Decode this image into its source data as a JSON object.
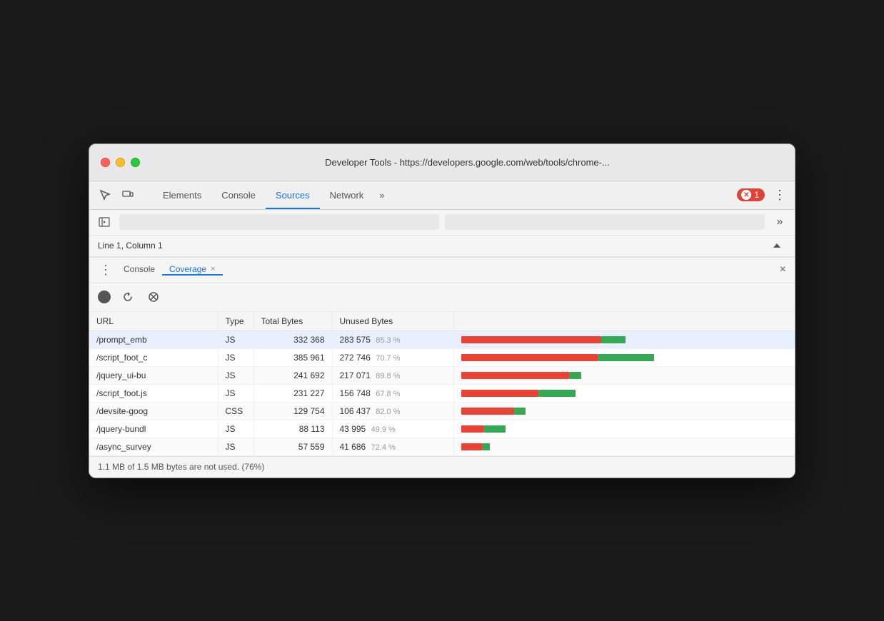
{
  "window": {
    "title": "Developer Tools - https://developers.google.com/web/tools/chrome-..."
  },
  "tabs": {
    "items": [
      {
        "id": "elements",
        "label": "Elements",
        "active": false
      },
      {
        "id": "console",
        "label": "Console",
        "active": false
      },
      {
        "id": "sources",
        "label": "Sources",
        "active": true
      },
      {
        "id": "network",
        "label": "Network",
        "active": false
      }
    ],
    "more_label": "»",
    "error_count": "1",
    "menu_label": "⋮"
  },
  "status": {
    "line_col": "Line 1, Column 1"
  },
  "drawer": {
    "tabs": [
      {
        "id": "console",
        "label": "Console",
        "active": false,
        "closable": false
      },
      {
        "id": "coverage",
        "label": "Coverage",
        "active": true,
        "closable": true
      }
    ],
    "close_label": "×"
  },
  "coverage": {
    "toolbar": {
      "record_title": "Start/Stop recording",
      "reload_title": "Reload and start recording",
      "clear_title": "Clear all"
    },
    "table": {
      "headers": [
        "URL",
        "Type",
        "Total Bytes",
        "Unused Bytes",
        ""
      ],
      "rows": [
        {
          "url": "/prompt_emb",
          "type": "JS",
          "total": "332 368",
          "unused": "283 575",
          "unused_pct": "85.3 %",
          "used_pct": 14.7,
          "bar_total_width": 230
        },
        {
          "url": "/script_foot_c",
          "type": "JS",
          "total": "385 961",
          "unused": "272 746",
          "unused_pct": "70.7 %",
          "used_pct": 29.3,
          "bar_total_width": 270
        },
        {
          "url": "/jquery_ui-bu",
          "type": "JS",
          "total": "241 692",
          "unused": "217 071",
          "unused_pct": "89.8 %",
          "used_pct": 10.2,
          "bar_total_width": 168
        },
        {
          "url": "/script_foot.js",
          "type": "JS",
          "total": "231 227",
          "unused": "156 748",
          "unused_pct": "67.8 %",
          "used_pct": 32.2,
          "bar_total_width": 160
        },
        {
          "url": "/devsite-goog",
          "type": "CSS",
          "total": "129 754",
          "unused": "106 437",
          "unused_pct": "82.0 %",
          "used_pct": 18.0,
          "bar_total_width": 90
        },
        {
          "url": "/jquery-bundl",
          "type": "JS",
          "total": "88 113",
          "unused": "43 995",
          "unused_pct": "49.9 %",
          "used_pct": 50.1,
          "bar_total_width": 62
        },
        {
          "url": "/async_survey",
          "type": "JS",
          "total": "57 559",
          "unused": "41 686",
          "unused_pct": "72.4 %",
          "used_pct": 27.6,
          "bar_total_width": 40
        }
      ]
    },
    "footer": "1.1 MB of 1.5 MB bytes are not used. (76%)"
  }
}
